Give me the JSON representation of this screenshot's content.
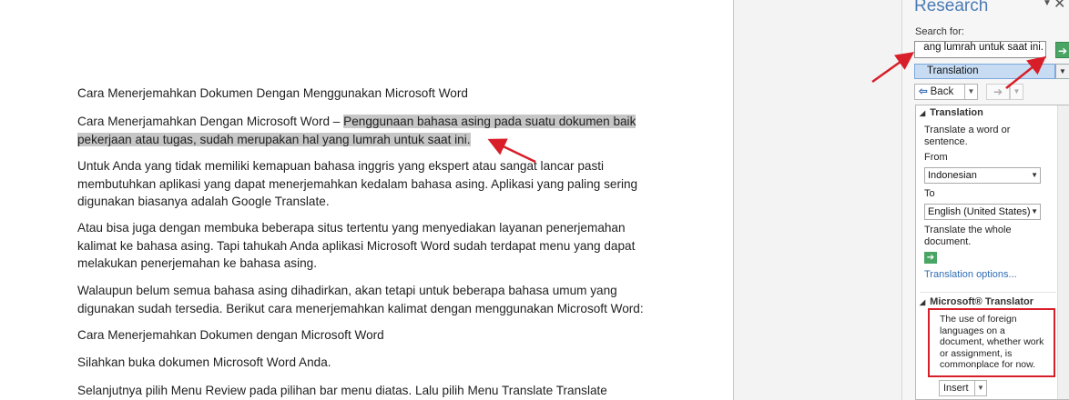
{
  "document": {
    "lines": [
      "Cara Menerjemahkan Dokumen Dengan Menggunakan Microsoft Word",
      "Cara Menerjamahkan Dengan Microsoft Word – ",
      "Penggunaan bahasa asing pada suatu dokumen baik",
      "pekerjaan atau tugas, sudah merupakan hal yang lumrah untuk saat ini.",
      "Untuk Anda yang tidak memiliki kemapuan bahasa inggris yang ekspert atau sangat lancar pasti",
      "membutuhkan aplikasi yang dapat menerjemahkan kedalam bahasa asing. Aplikasi yang paling sering",
      "digunakan biasanya adalah Google Translate.",
      "Atau bisa juga dengan membuka beberapa situs tertentu yang menyediakan layanan penerjemahan",
      "kalimat ke bahasa asing. Tapi tahukah Anda aplikasi Microsoft Word sudah terdapat menu yang dapat",
      "melakukan penerjemahan ke bahasa asing.",
      "Walaupun belum semua bahasa asing dihadirkan, akan tetapi untuk beberapa bahasa umum yang",
      "digunakan sudah tersedia. Berikut cara menerjemahkan kalimat dengan menggunakan Microsoft Word:",
      " Cara Menerjemahkan Dokumen dengan Microsoft Word",
      "Silahkan buka dokumen Microsoft Word Anda.",
      "Selanjutnya pilih Menu Review pada pilihan bar menu diatas. Lalu pilih Menu Translate Translate"
    ]
  },
  "research_pane": {
    "title": "Research",
    "search_label": "Search for:",
    "search_value": "ang lumrah untuk saat ini.",
    "service": "Translation",
    "back_label": "Back",
    "translation_section": "Translation",
    "translate_word_text": "Translate a word or\nsentence.",
    "from_label": "From",
    "from_value": "Indonesian",
    "to_label": "To",
    "to_value": "English (United States)",
    "translate_doc_text": "Translate the whole\ndocument.",
    "options_link": "Translation options...",
    "ms_translator_section": "Microsoft® Translator",
    "result_text": "The use of foreign\nlanguages on a\ndocument, whether work\nor assignment, is\ncommonplace for now.",
    "insert_label": "Insert"
  },
  "colors": {
    "highlight": "#c6c6c6",
    "pane_title": "#4b7bb5",
    "annotation": "#d81e28",
    "go_button": "#4aa564",
    "link": "#2f6db5"
  },
  "icons": [
    "chevron-down-icon",
    "close-icon",
    "go-arrow-icon",
    "back-arrow-icon",
    "forward-arrow-icon",
    "collapse-triangle-icon"
  ]
}
